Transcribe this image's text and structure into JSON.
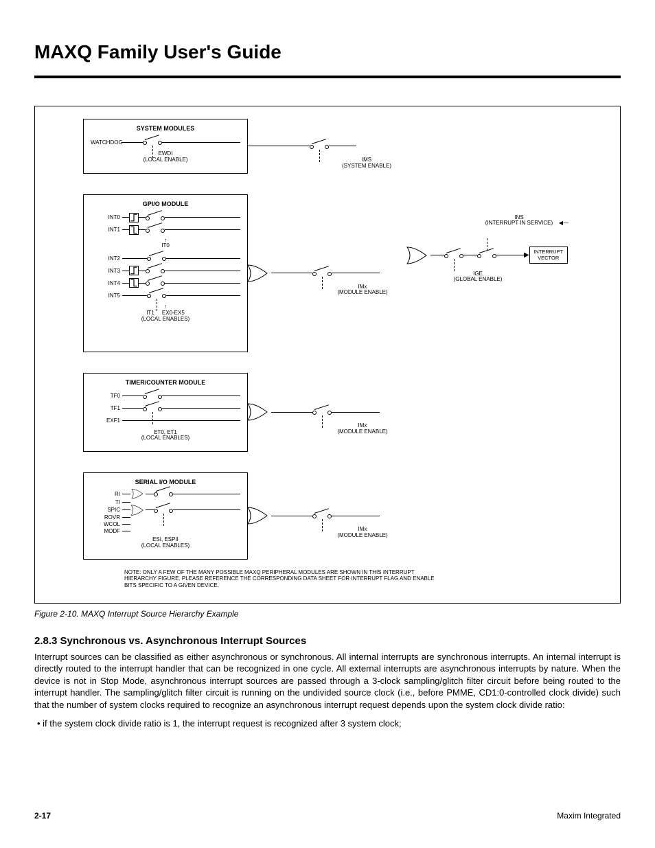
{
  "page": {
    "title": "MAXQ Family User's Guide",
    "page_number": "2-17",
    "publisher": "Maxim Integrated"
  },
  "figure": {
    "caption": "Figure 2-10. MAXQ Interrupt Source Hierarchy Example",
    "note": "NOTE: ONLY A FEW OF THE MANY POSSIBLE MAXQ PERIPHERAL MODULES ARE SHOWN IN THIS INTERRUPT HIERARCHY FIGURE. PLEASE REFERENCE THE CORRESPONDING DATA SHEET FOR INTERRUPT FLAG AND ENABLE BITS SPECIFIC TO A GIVEN DEVICE.",
    "modules": {
      "system": {
        "title": "SYSTEM MODULES",
        "signals": [
          "WATCHDOG"
        ],
        "local_enable_line1": "EWDI",
        "local_enable_line2": "(LOCAL ENABLE)",
        "module_enable_line1": "IMS",
        "module_enable_line2": "(SYSTEM ENABLE)"
      },
      "gpio": {
        "title": "GPI/O MODULE",
        "signals": [
          "INT0",
          "INT1",
          "INT2",
          "INT3",
          "INT4",
          "INT5"
        ],
        "it_labels": [
          "IT0",
          "IT1"
        ],
        "local_enable_line1": "EX0-EX5",
        "local_enable_line2": "(LOCAL ENABLES)",
        "module_enable_line1": "IMx",
        "module_enable_line2": "(MODULE ENABLE)"
      },
      "timer": {
        "title": "TIMER/COUNTER MODULE",
        "signals": [
          "TF0",
          "TF1",
          "EXF1"
        ],
        "local_enable_line1": "ET0, ET1",
        "local_enable_line2": "(LOCAL ENABLES)",
        "module_enable_line1": "IMx",
        "module_enable_line2": "(MODULE ENABLE)"
      },
      "serial": {
        "title": "SERIAL I/O MODULE",
        "signals": [
          "RI",
          "TI",
          "SPIC",
          "ROVR",
          "WCOL",
          "MODF"
        ],
        "local_enable_line1": "ESI, ESPII",
        "local_enable_line2": "(LOCAL ENABLES)",
        "module_enable_line1": "IMx",
        "module_enable_line2": "(MODULE ENABLE)"
      }
    },
    "right": {
      "ins_line1": "INS",
      "ins_line2": "(INTERRUPT IN SERVICE)",
      "ige_line1": "IGE",
      "ige_line2": "(GLOBAL ENABLE)",
      "vector_line1": "INTERRUPT",
      "vector_line2": "VECTOR"
    }
  },
  "section": {
    "heading": "2.8.3 Synchronous vs. Asynchronous Interrupt Sources",
    "body": "Interrupt sources can be classified as either asynchronous or synchronous. All internal interrupts are synchronous interrupts. An internal interrupt is directly routed to the interrupt handler that can be recognized in one cycle. All external interrupts are asynchronous interrupts by nature. When the device is not in Stop Mode, asynchronous interrupt sources are passed through a 3-clock sampling/glitch filter circuit before being routed to the interrupt handler. The sampling/glitch filter circuit is running on the undivided source clock (i.e., before PMME, CD1:0-controlled clock divide) such that the number of system clocks required to recognize an asynchronous interrupt request depends upon the system clock divide ratio:",
    "bullet1": "• if the system clock divide ratio is 1, the interrupt request is recognized after 3 system clock;"
  }
}
